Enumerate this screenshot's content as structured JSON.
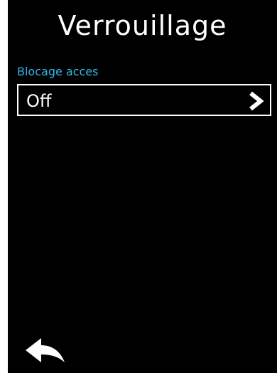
{
  "header": {
    "title": "Verrouillage"
  },
  "section": {
    "label": "Blocage acces",
    "value": "Off"
  },
  "icons": {
    "next": "chevron-right-icon",
    "back": "back-arrow-icon"
  },
  "colors": {
    "background": "#000000",
    "foreground": "#ffffff",
    "accent": "#2fb7e8"
  }
}
